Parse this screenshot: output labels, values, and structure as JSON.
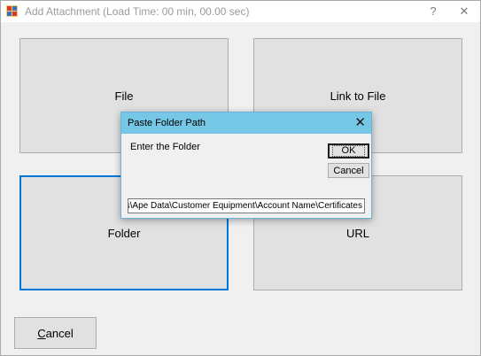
{
  "window": {
    "title": "Add Attachment (Load Time: 00 min, 00.00 sec)",
    "help_glyph": "?",
    "close_glyph": "✕"
  },
  "tiles": {
    "file": "File",
    "link_to_file": "Link to File",
    "folder": "Folder",
    "url": "URL"
  },
  "cancel_button": {
    "accel": "C",
    "rest": "ancel"
  },
  "dialog": {
    "title": "Paste Folder Path",
    "close_glyph": "✕",
    "prompt": "Enter the Folder",
    "ok_label": "OK",
    "cancel_label": "Cancel",
    "path_value": "d_X_Files\\Ape Data\\Customer Equipment\\Account Name\\Certificates"
  },
  "colors": {
    "focus_border": "#0078d7",
    "dialog_title_bg": "#76c6e6",
    "button_bg": "#e1e1e1"
  }
}
